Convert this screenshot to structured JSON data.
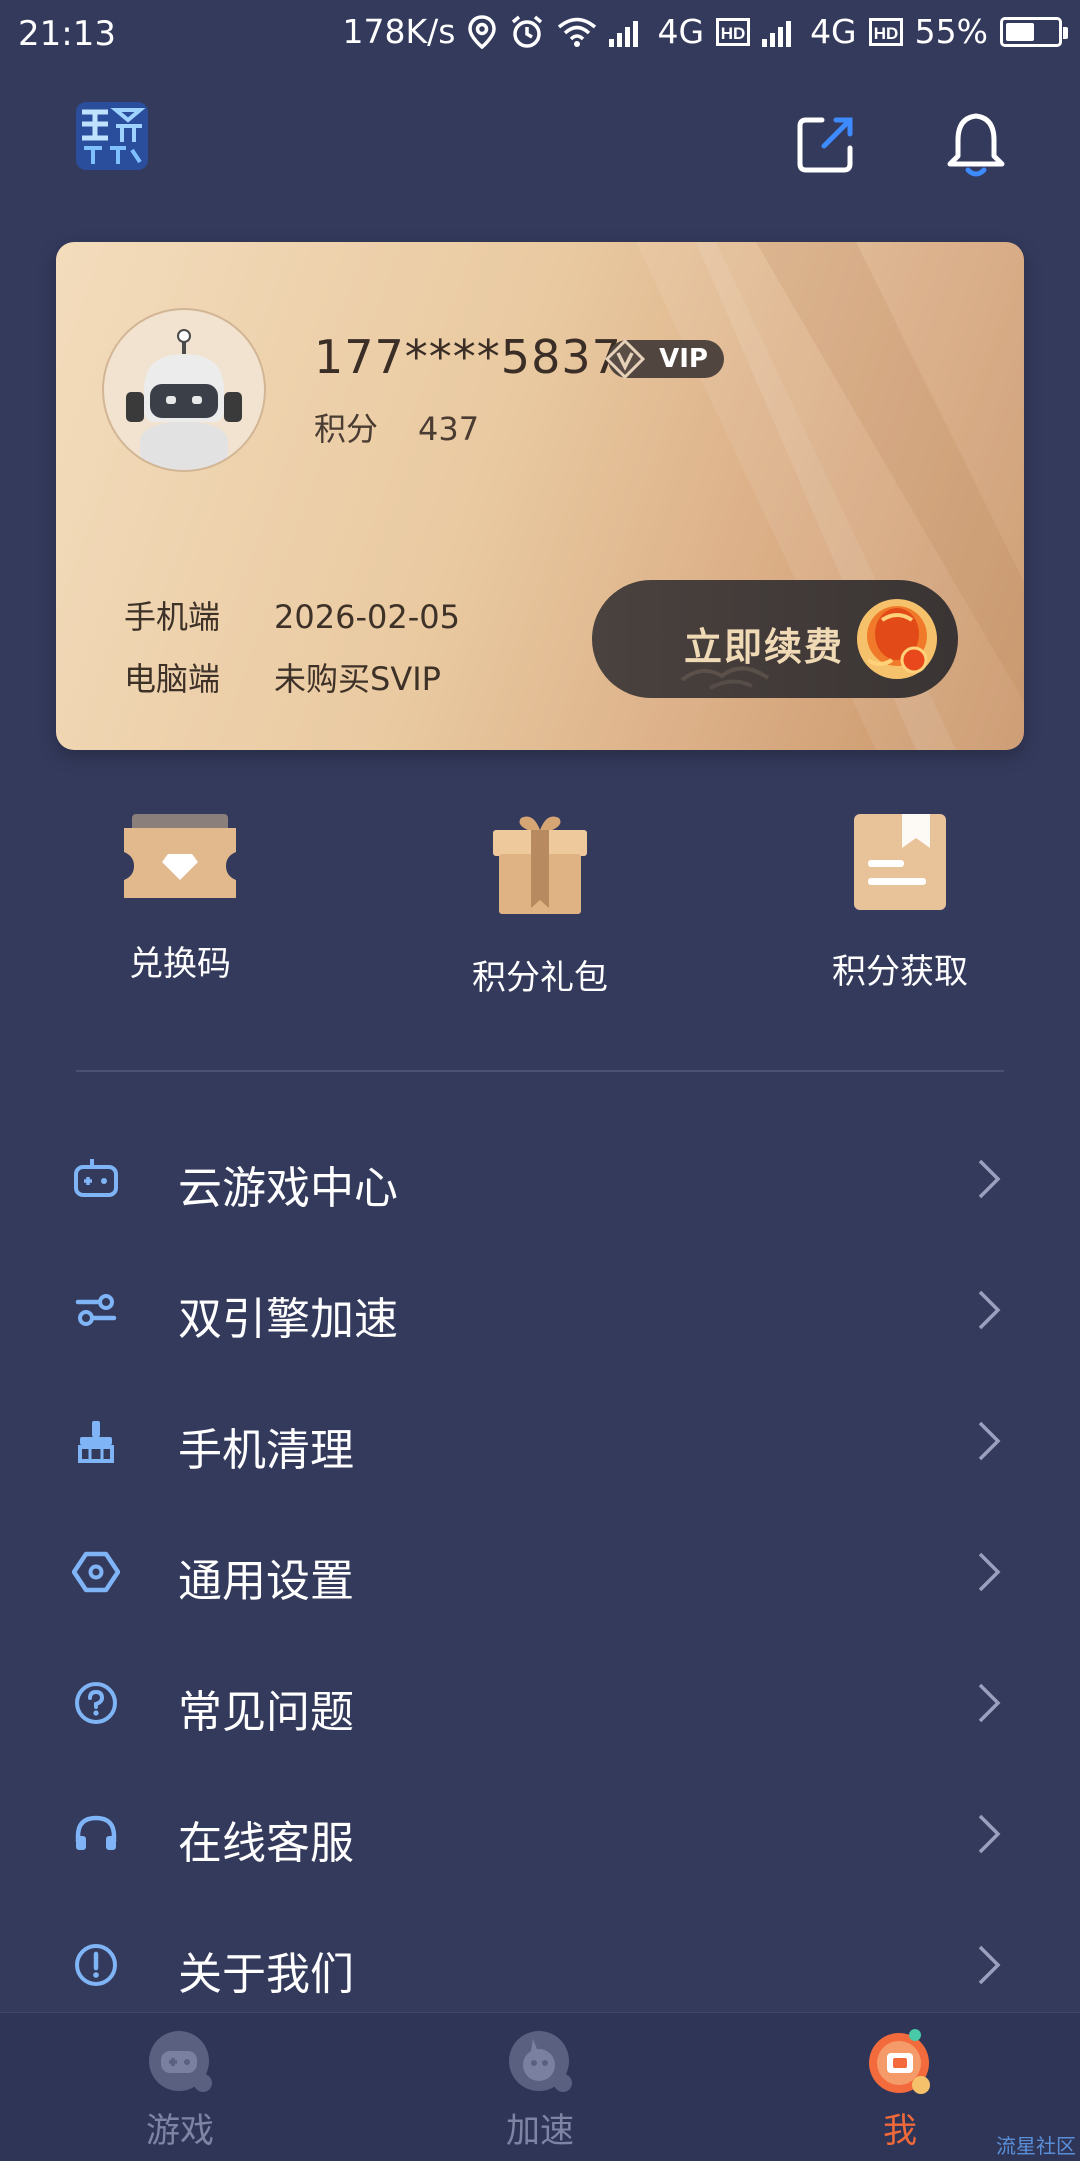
{
  "status_bar": {
    "time": "21:13",
    "net_speed": "178K/s",
    "sim1": "4G",
    "sim2": "4G",
    "battery": "55%",
    "battery_level": 0.55
  },
  "header": {
    "logo_icon": "wangzhe-training-logo",
    "edit_icon": "edit-icon",
    "bell_icon": "bell-icon"
  },
  "member_card": {
    "phone": "177****5837",
    "vip_label": "VIP",
    "points_label": "积分",
    "points_value": "437",
    "mobile_label": "手机端",
    "mobile_value": "2026-02-05",
    "pc_label": "电脑端",
    "pc_value": "未购买SVIP",
    "renew_label": "立即续费"
  },
  "quick_actions": [
    {
      "label": "兑换码",
      "icon": "ticket-icon"
    },
    {
      "label": "积分礼包",
      "icon": "gift-icon"
    },
    {
      "label": "积分获取",
      "icon": "book-icon"
    }
  ],
  "menu": [
    {
      "label": "云游戏中心",
      "icon": "gamepad-icon"
    },
    {
      "label": "双引擎加速",
      "icon": "dual-engine-icon"
    },
    {
      "label": "手机清理",
      "icon": "broom-icon"
    },
    {
      "label": "通用设置",
      "icon": "hexagon-settings-icon"
    },
    {
      "label": "常见问题",
      "icon": "question-icon"
    },
    {
      "label": "在线客服",
      "icon": "headset-icon"
    },
    {
      "label": "关于我们",
      "icon": "info-icon"
    }
  ],
  "bottom_nav": [
    {
      "label": "游戏",
      "active": false
    },
    {
      "label": "加速",
      "active": false
    },
    {
      "label": "我",
      "active": true
    }
  ],
  "watermark": "流星社区",
  "colors": {
    "background": "#343a5c",
    "accent": "#f0693a",
    "icon_blue": "#7fb4f6"
  }
}
